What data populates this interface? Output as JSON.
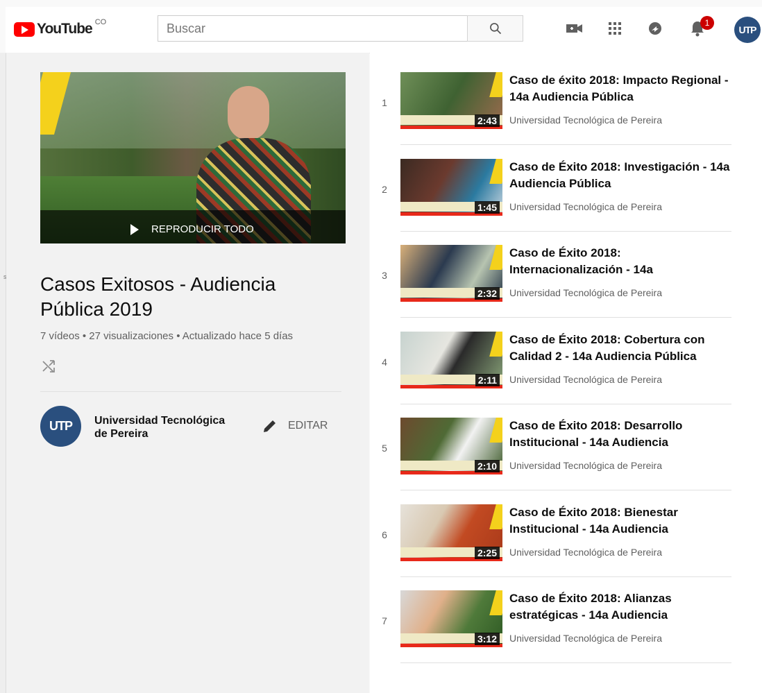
{
  "header": {
    "logo_text": "YouTube",
    "country": "CO",
    "search_placeholder": "Buscar",
    "notification_count": "1",
    "avatar_text": "UTP"
  },
  "playlist": {
    "play_all_label": "REPRODUCIR TODO",
    "title": "Casos Exitosos - Audiencia Pública 2019",
    "stats": "7 vídeos • 27 visualizaciones • Actualizado hace 5 días",
    "owner_name": "Universidad Tecnológica de Pereira",
    "owner_avatar_text": "UTP",
    "edit_label": "EDITAR"
  },
  "videos": [
    {
      "index": "1",
      "title": "Caso de éxito 2018: Impacto Regional - 14a Audiencia Pública",
      "channel": "Universidad Tecnológica de Pereira",
      "duration": "2:43"
    },
    {
      "index": "2",
      "title": "Caso de Éxito 2018: Investigación - 14a Audiencia Pública",
      "channel": "Universidad Tecnológica de Pereira",
      "duration": "1:45"
    },
    {
      "index": "3",
      "title": "Caso de Éxito 2018: Internacionalización - 14a",
      "channel": "Universidad Tecnológica de Pereira",
      "duration": "2:32"
    },
    {
      "index": "4",
      "title": "Caso de Éxito 2018: Cobertura con Calidad 2 - 14a Audiencia Pública",
      "channel": "Universidad Tecnológica de Pereira",
      "duration": "2:11"
    },
    {
      "index": "5",
      "title": "Caso de Éxito 2018: Desarrollo Institucional - 14a Audiencia",
      "channel": "Universidad Tecnológica de Pereira",
      "duration": "2:10"
    },
    {
      "index": "6",
      "title": "Caso de Éxito 2018: Bienestar Institucional - 14a Audiencia",
      "channel": "Universidad Tecnológica de Pereira",
      "duration": "2:25"
    },
    {
      "index": "7",
      "title": "Caso de Éxito 2018: Alianzas estratégicas - 14a Audiencia",
      "channel": "Universidad Tecnológica de Pereira",
      "duration": "3:12"
    }
  ],
  "colors": {
    "brand_red": "#ff0000",
    "badge_red": "#cc0000",
    "utp_blue": "#2a4f7e",
    "accent_yellow": "#f4d11c"
  }
}
